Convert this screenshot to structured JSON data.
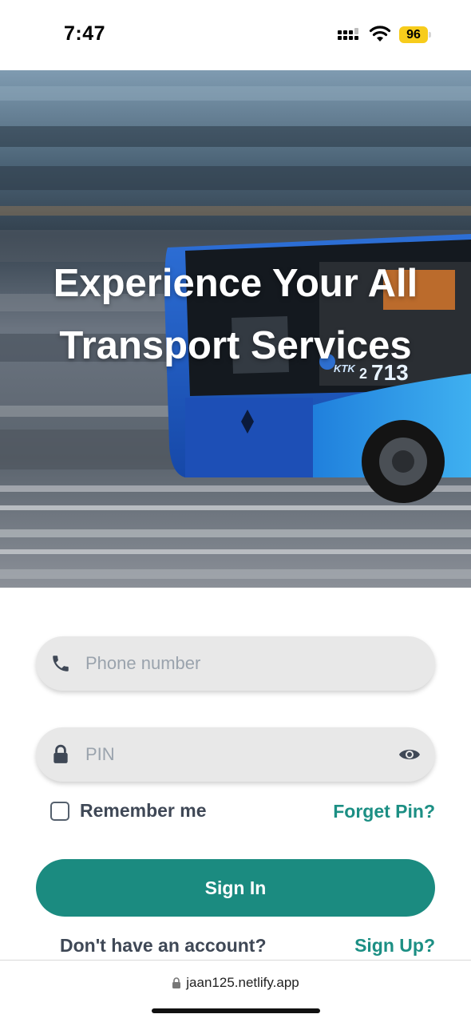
{
  "status_bar": {
    "time": "7:47",
    "battery": "96",
    "icons": [
      "signal-icon",
      "wifi-icon",
      "battery-icon"
    ]
  },
  "hero": {
    "title_line1": "Experience Your All",
    "title_line2": "Transport Services",
    "bus_number": "713",
    "bus_route_prefix": "2",
    "bus_logo": "KTK"
  },
  "form": {
    "phone_placeholder": "Phone number",
    "pin_placeholder": "PIN",
    "remember_label": "Remember me",
    "forget_label": "Forget Pin?",
    "signin_label": "Sign In",
    "no_account_label": "Don't have an account?",
    "signup_label": "Sign Up?"
  },
  "browser": {
    "url": "jaan125.netlify.app"
  },
  "colors": {
    "accent": "#1b8b80",
    "link": "#1c8f84",
    "field_bg": "#e8e8e8",
    "battery": "#f7cc1c"
  }
}
